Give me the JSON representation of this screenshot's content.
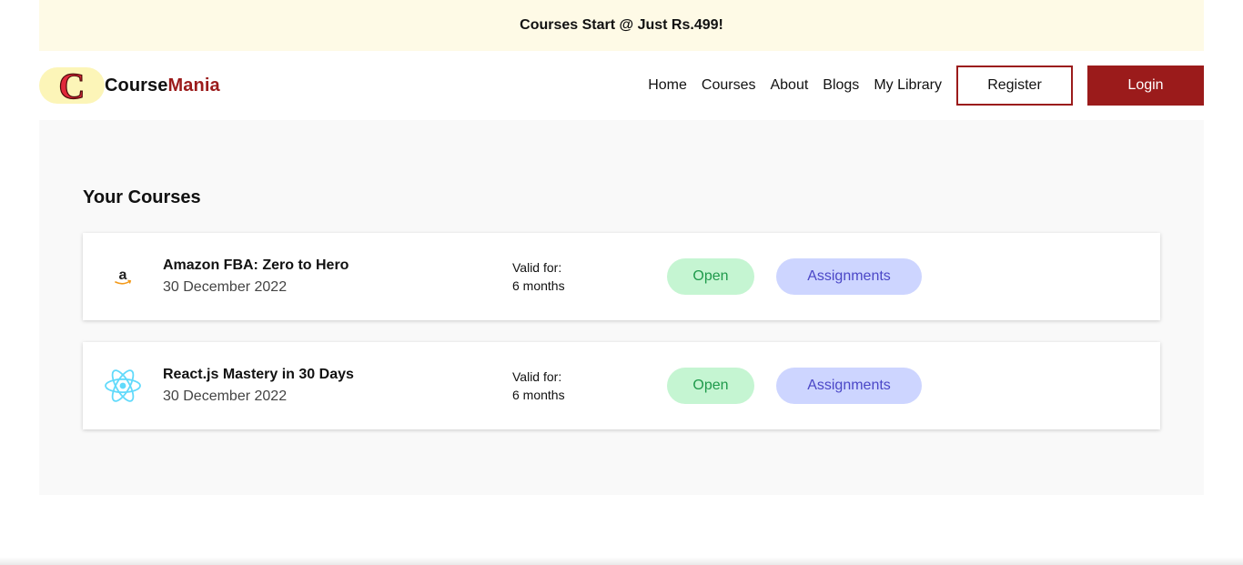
{
  "banner": {
    "text": "Courses Start @ Just Rs.499!"
  },
  "brand": {
    "part1": "Course",
    "part2": "Mania",
    "logo_letter": "C",
    "accent_color": "#9b1b1b"
  },
  "nav": {
    "links": [
      "Home",
      "Courses",
      "About",
      "Blogs",
      "My Library"
    ],
    "register_label": "Register",
    "login_label": "Login"
  },
  "main": {
    "title": "Your Courses",
    "courses": [
      {
        "name": "Amazon FBA: Zero to Hero",
        "date": "30 December 2022",
        "valid_label": "Valid for:",
        "valid_value": "6 months",
        "open_label": "Open",
        "assignments_label": "Assignments",
        "icon": "amazon-icon"
      },
      {
        "name": "React.js Mastery in 30 Days",
        "date": "30 December 2022",
        "valid_label": "Valid for:",
        "valid_value": "6 months",
        "open_label": "Open",
        "assignments_label": "Assignments",
        "icon": "react-icon"
      }
    ]
  }
}
